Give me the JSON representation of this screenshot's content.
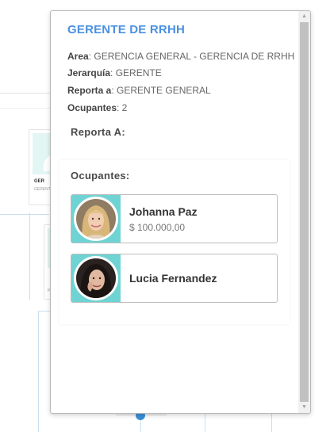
{
  "background": {
    "card_name": "GER",
    "card_sub": "GERENT",
    "card2_sub": "P"
  },
  "popover": {
    "title": "GERENTE DE RRHH",
    "info": {
      "area_label": "Area",
      "area_value": ": GERENCIA GENERAL - GERENCIA DE RRHH",
      "jerarquia_label": "Jerarquía",
      "jerarquia_value": ": GERENTE",
      "reporta_label": "Reporta a",
      "reporta_value": ": GERENTE GENERAL",
      "ocupantes_label": "Ocupantes",
      "ocupantes_value": ": 2"
    },
    "reporta_section_label": "Reporta A:",
    "ocupantes_section_label": "Ocupantes:",
    "occupants": [
      {
        "name": "Johanna Paz",
        "salary": "$ 100.000,00",
        "avatar_icon": "person-photo-blonde"
      },
      {
        "name": "Lucia Fernandez",
        "avatar_icon": "person-photo-dark-hair"
      }
    ],
    "scrollbar": {
      "up_icon": "scroll-up-arrow-icon",
      "down_icon": "scroll-down-arrow-icon"
    }
  },
  "colors": {
    "title": "#4a90e2",
    "avatar_band": "#6fd3d3",
    "org_dot": "#3b8fd8"
  }
}
